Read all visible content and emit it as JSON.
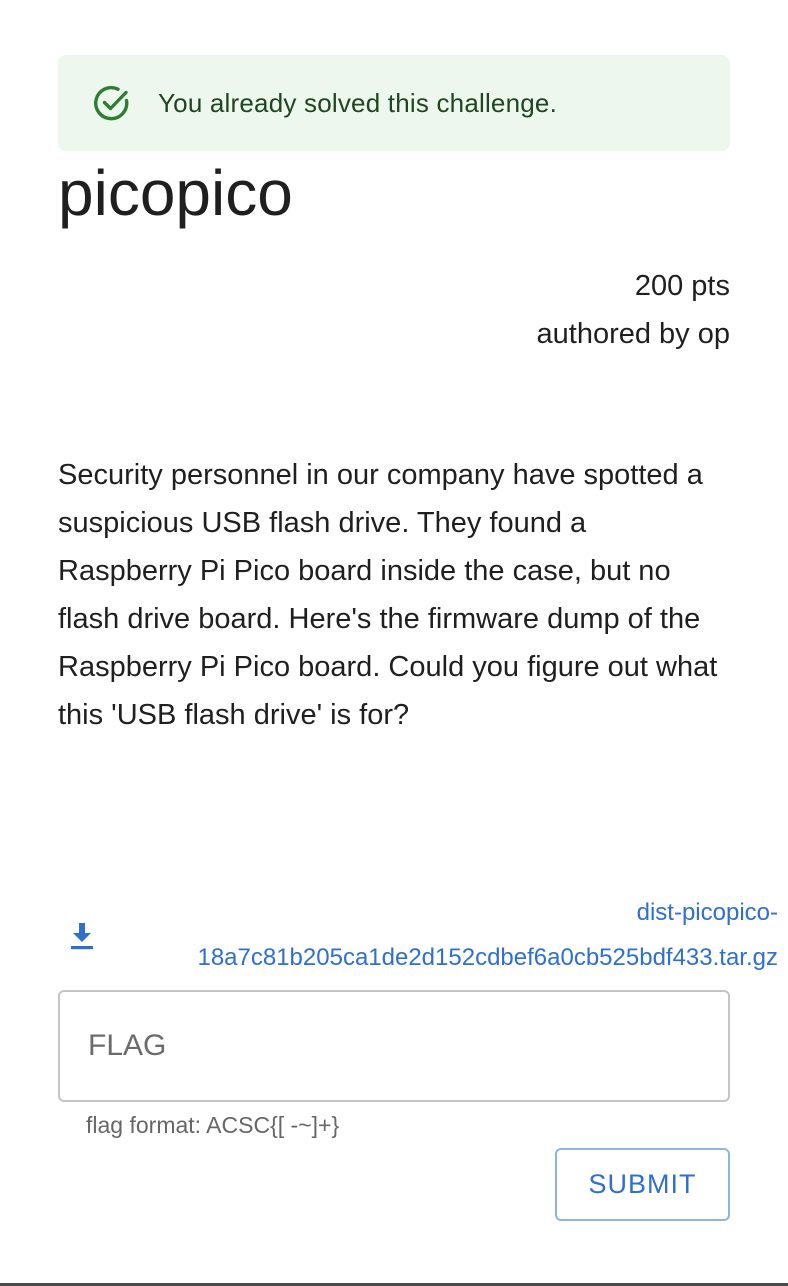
{
  "alert": {
    "message": "You already solved this challenge.",
    "icon": "check-circle-outline-icon",
    "color": "#2e7d32",
    "background": "#edf7ed"
  },
  "challenge": {
    "title": "picopico",
    "points": "200 pts",
    "author": "authored by op",
    "description": "Security personnel in our company have spotted a suspicious USB flash drive. They found a Raspberry Pi Pico board inside the case, but no flash drive board. Here's the firmware dump of the Raspberry Pi Pico board. Could you figure out what this 'USB flash drive' is for?"
  },
  "attachment": {
    "icon": "download-icon",
    "filename_line1": "dist-picopico-",
    "filename_line2": "18a7c81b205ca1de2d152cdbef6a0cb525bdf433.tar.gz",
    "color": "#2f6fd0"
  },
  "flag_form": {
    "placeholder": "FLAG",
    "value": "",
    "helper": "flag format: ACSC{[ -~]+}",
    "submit_label": "SUBMIT"
  }
}
